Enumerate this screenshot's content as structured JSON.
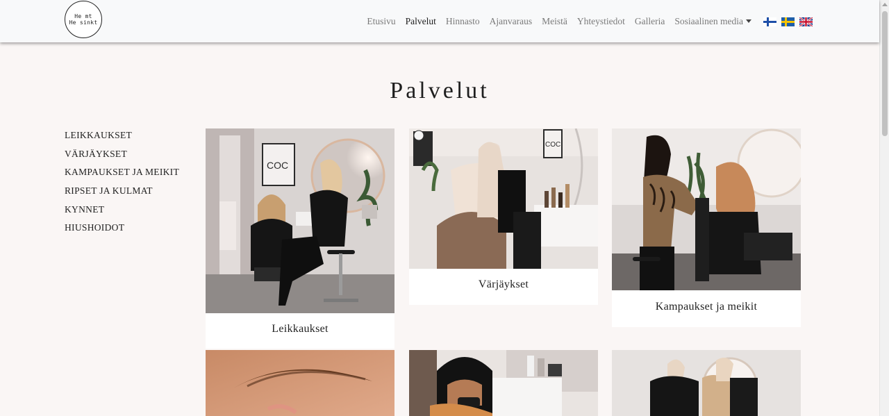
{
  "brand": {
    "logo_text": "He mt\nHe sinkt"
  },
  "nav": {
    "items": [
      {
        "label": "Etusivu",
        "active": false
      },
      {
        "label": "Palvelut",
        "active": true
      },
      {
        "label": "Hinnasto",
        "active": false
      },
      {
        "label": "Ajanvaraus",
        "active": false
      },
      {
        "label": "Meistä",
        "active": false
      },
      {
        "label": "Yhteystiedot",
        "active": false
      },
      {
        "label": "Galleria",
        "active": false
      },
      {
        "label": "Sosiaalinen media",
        "active": false,
        "dropdown": true
      }
    ],
    "flags": [
      "flag-fi-icon",
      "flag-se-icon",
      "flag-gb-icon"
    ]
  },
  "page": {
    "title": "Palvelut"
  },
  "sidebar": {
    "items": [
      {
        "label": "LEIKKAUKSET"
      },
      {
        "label": "VÄRJÄYKSET"
      },
      {
        "label": "KAMPAUKSET JA MEIKIT"
      },
      {
        "label": "RIPSET JA KULMAT"
      },
      {
        "label": "KYNNET"
      },
      {
        "label": "HIUSHOIDOT"
      }
    ]
  },
  "cards": [
    {
      "label": "Leikkaukset",
      "image": "salon-haircut-photo"
    },
    {
      "label": "Värjäykset",
      "image": "hair-coloring-photo"
    },
    {
      "label": "Kampaukset ja meikit",
      "image": "hairstyling-photo"
    },
    {
      "label": "",
      "image": "eyebrow-photo"
    },
    {
      "label": "",
      "image": "nail-technician-photo"
    },
    {
      "label": "",
      "image": "hair-treatment-photo"
    }
  ],
  "colors": {
    "background": "#faf6f5",
    "navbar": "#f8f9fa",
    "text": "#1e1e1e",
    "nav_muted": "#7a7a7a"
  }
}
